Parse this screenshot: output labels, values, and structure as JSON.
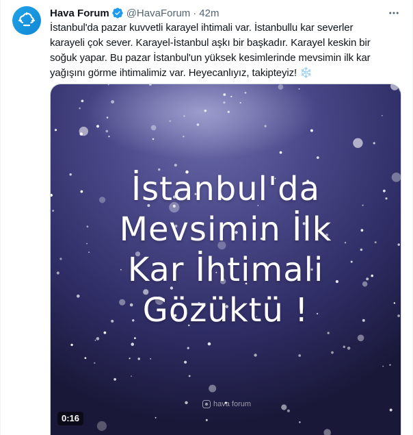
{
  "author": {
    "display_name": "Hava Forum",
    "handle": "@HavaForum",
    "separator": "·",
    "time": "42m",
    "verified": true,
    "avatar_icon": "cloud-sun-logo-icon"
  },
  "tweet": {
    "lines": [
      "İstanbul'da pazar kuvvetli karayel ihtimali var. İstanbullu kar severler",
      "karayeli çok sever. Karayel-İstanbul aşkı bir başkadır. Karayel keskin bir",
      "soğuk yapar. Bu pazar İstanbul'un yüksek kesimlerinde mevsimin ilk kar",
      "yağışını görme ihtimalimiz var. Heyecanlıyız, takipteyiz!"
    ],
    "emoji": "❄️"
  },
  "media": {
    "type": "video",
    "title_lines": [
      "İstanbul'da",
      "Mevsimin İlk",
      "Kar İhtimali",
      "Gözüktü !"
    ],
    "watermark": "hava forum",
    "duration": "0:16"
  },
  "colors": {
    "accent": "#1d9bf0",
    "text_primary": "#0f1419",
    "text_secondary": "#536471",
    "media_bg_top": "#3d3b78",
    "media_bg_bottom": "#1b1a3f"
  },
  "icons": {
    "verified": "verified-badge-icon",
    "more": "more-dots-icon"
  }
}
